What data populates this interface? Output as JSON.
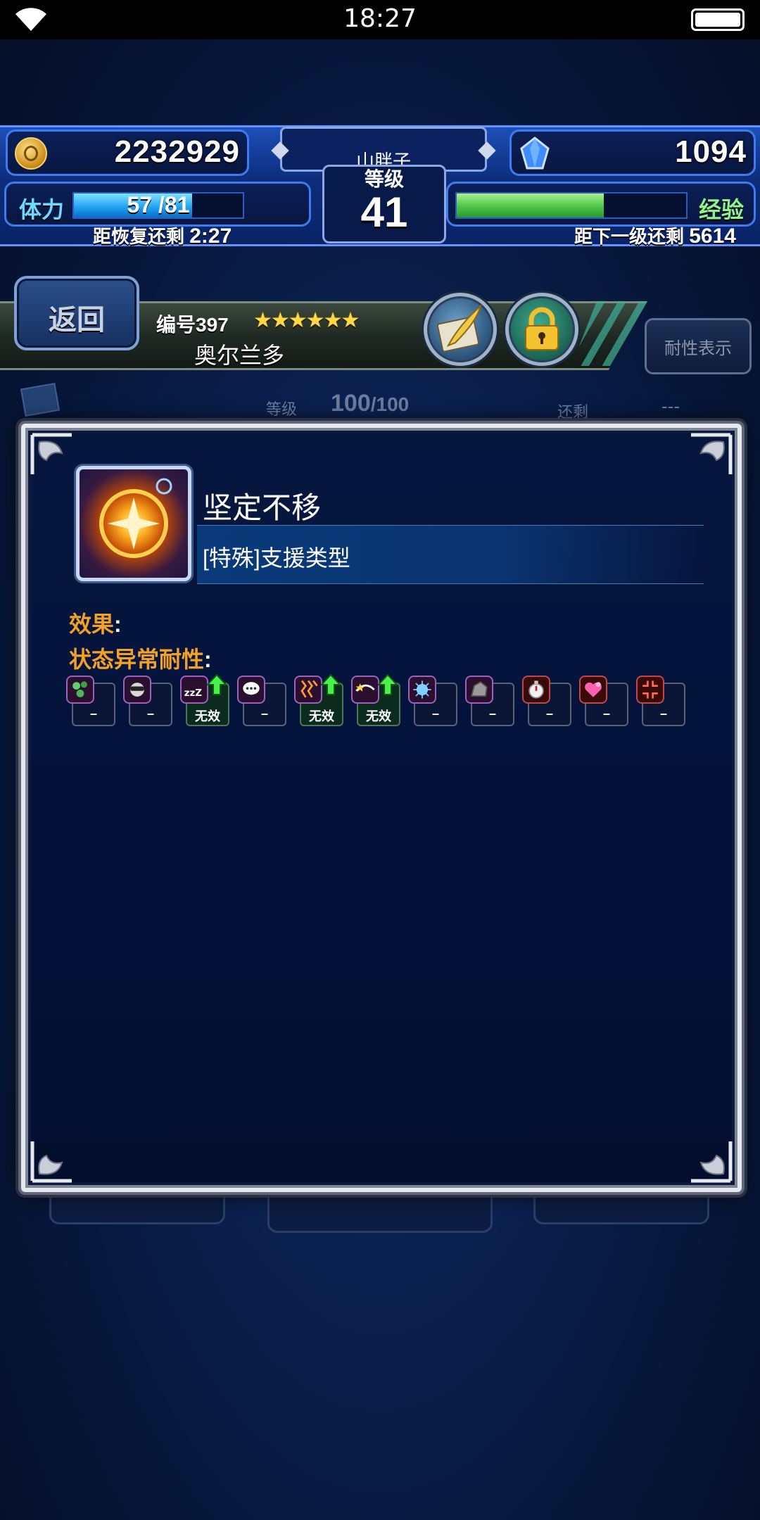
{
  "status_bar": {
    "time": "18:27"
  },
  "hud": {
    "gil": "2232929",
    "gems": "1094",
    "player_name": "山胖子",
    "level_label": "等级",
    "level": "41",
    "stamina_label": "体力",
    "stamina_text": "57 /81",
    "stamina_fraction": 0.7,
    "recover_label": "距恢复还剩",
    "recover_time": "2:27",
    "exp_label": "经验",
    "exp_fraction": 0.64,
    "next_label": "距下一级还剩",
    "next_value": "5614"
  },
  "character": {
    "back_label": "返回",
    "number": "编号397",
    "stars": "★★★★★★",
    "name": "奥尔兰多",
    "resist_button": "耐性表示"
  },
  "background_stats": {
    "level_label": "等级",
    "level_value": "100",
    "level_max": "/100",
    "remain_label": "还剩",
    "remain_value": "---"
  },
  "modal": {
    "ability_name": "坚定不移",
    "ability_type": "[特殊]支援类型",
    "effect_label": "效果",
    "resist_label": "状态异常耐性",
    "colon": ":",
    "resistances": [
      {
        "icon": "poison-icon",
        "value": "–",
        "boosted": false,
        "ok": false,
        "tint": "purple"
      },
      {
        "icon": "blind-icon",
        "value": "–",
        "boosted": false,
        "ok": false,
        "tint": "purple"
      },
      {
        "icon": "sleep-icon",
        "value": "无效",
        "boosted": true,
        "ok": true,
        "tint": "purple"
      },
      {
        "icon": "silence-icon",
        "value": "–",
        "boosted": false,
        "ok": false,
        "tint": "purple"
      },
      {
        "icon": "paralyze-icon",
        "value": "无效",
        "boosted": true,
        "ok": true,
        "tint": "purple"
      },
      {
        "icon": "confuse-icon",
        "value": "无效",
        "boosted": true,
        "ok": true,
        "tint": "purple"
      },
      {
        "icon": "disease-icon",
        "value": "–",
        "boosted": false,
        "ok": false,
        "tint": "purple"
      },
      {
        "icon": "petrify-icon",
        "value": "–",
        "boosted": false,
        "ok": false,
        "tint": "purple"
      },
      {
        "icon": "stop-icon",
        "value": "–",
        "boosted": false,
        "ok": false,
        "tint": "red"
      },
      {
        "icon": "charm-icon",
        "value": "–",
        "boosted": false,
        "ok": false,
        "tint": "red"
      },
      {
        "icon": "break-icon",
        "value": "–",
        "boosted": false,
        "ok": false,
        "tint": "red"
      }
    ]
  },
  "colors": {
    "accent_orange": "#f2a02a",
    "stamina_blue": "#1f9ef0",
    "exp_green": "#4bc44a"
  }
}
